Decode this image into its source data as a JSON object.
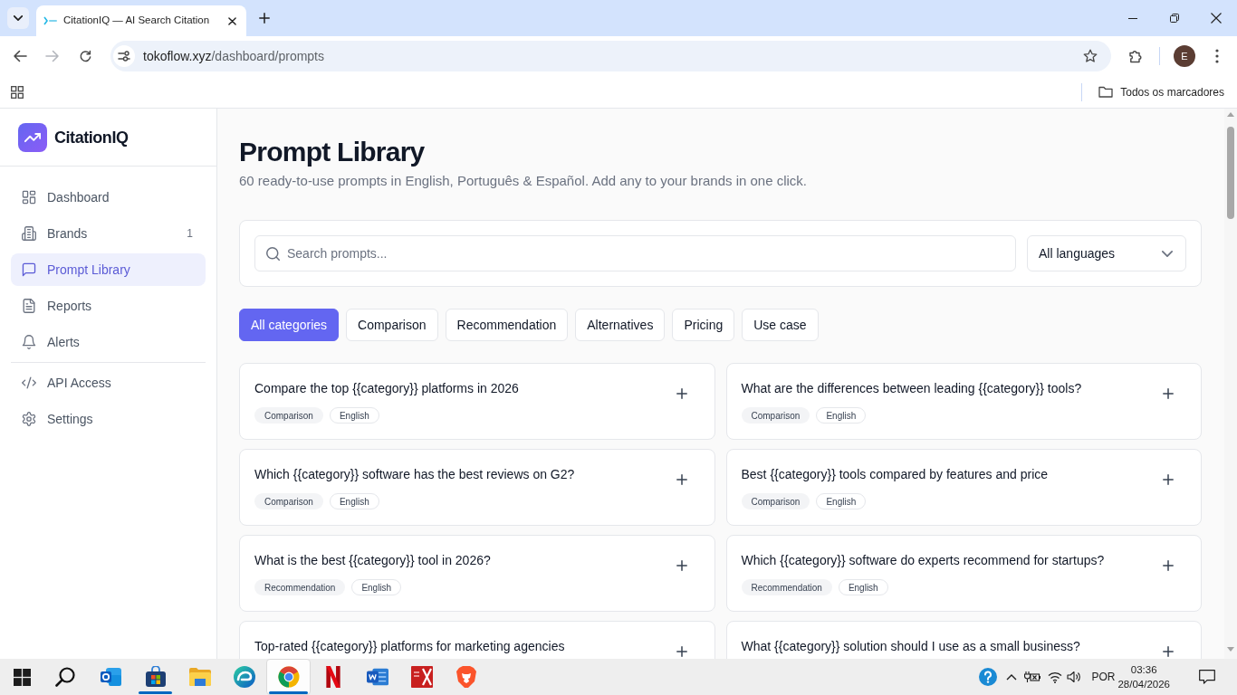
{
  "browser": {
    "tabs": [
      {
        "title": "CitationIQ — AI Search Citation",
        "selected": true
      }
    ],
    "address": {
      "host": "tokoflow.xyz",
      "path": "/dashboard/prompts"
    },
    "profile_initial": "E",
    "bookmarks_folder": "Todos os marcadores"
  },
  "sidebar": {
    "brand": "CitationIQ",
    "nav_groups": [
      [
        {
          "label": "Dashboard",
          "selected": false
        },
        {
          "label": "Brands",
          "count": "1",
          "selected": false
        },
        {
          "label": "Prompt Library",
          "selected": true
        },
        {
          "label": "Reports",
          "selected": false
        },
        {
          "label": "Alerts",
          "selected": false
        }
      ],
      [
        {
          "label": "API Access",
          "selected": false
        },
        {
          "label": "Settings",
          "selected": false
        }
      ]
    ]
  },
  "page": {
    "title": "Prompt Library",
    "subtitle": "60 ready-to-use prompts in English, Português & Español. Add any to your brands in one click."
  },
  "filters": {
    "search": {
      "placeholder": "Search prompts..."
    },
    "language": {
      "value": "All languages"
    },
    "categories": [
      {
        "label": "All categories",
        "selected": true
      },
      {
        "label": "Comparison",
        "selected": false
      },
      {
        "label": "Recommendation",
        "selected": false
      },
      {
        "label": "Alternatives",
        "selected": false
      },
      {
        "label": "Pricing",
        "selected": false
      },
      {
        "label": "Use case",
        "selected": false
      }
    ]
  },
  "prompts": [
    {
      "text": "Compare the top {{category}} platforms in 2026",
      "tags": [
        {
          "label": "Comparison",
          "kind": "category"
        },
        {
          "label": "English",
          "kind": "language"
        }
      ]
    },
    {
      "text": "What are the differences between leading {{category}} tools?",
      "tags": [
        {
          "label": "Comparison",
          "kind": "category"
        },
        {
          "label": "English",
          "kind": "language"
        }
      ]
    },
    {
      "text": "Which {{category}} software has the best reviews on G2?",
      "tags": [
        {
          "label": "Comparison",
          "kind": "category"
        },
        {
          "label": "English",
          "kind": "language"
        }
      ]
    },
    {
      "text": "Best {{category}} tools compared by features and price",
      "tags": [
        {
          "label": "Comparison",
          "kind": "category"
        },
        {
          "label": "English",
          "kind": "language"
        }
      ]
    },
    {
      "text": "What is the best {{category}} tool in 2026?",
      "tags": [
        {
          "label": "Recommendation",
          "kind": "category"
        },
        {
          "label": "English",
          "kind": "language"
        }
      ]
    },
    {
      "text": "Which {{category}} software do experts recommend for startups?",
      "tags": [
        {
          "label": "Recommendation",
          "kind": "category"
        },
        {
          "label": "English",
          "kind": "language"
        }
      ]
    },
    {
      "text": "Top-rated {{category}} platforms for marketing agencies"
    },
    {
      "text": "What {{category}} solution should I use as a small business?"
    }
  ],
  "taskbar": {
    "apps": [
      {
        "running": false,
        "selected": false
      },
      {
        "running": true,
        "selected": false
      },
      {
        "running": false,
        "selected": false
      },
      {
        "running": false,
        "selected": false
      },
      {
        "running": true,
        "selected": true
      },
      {
        "running": false,
        "selected": false
      },
      {
        "running": false,
        "selected": false
      },
      {
        "running": false,
        "selected": false
      },
      {
        "running": false,
        "selected": false
      }
    ],
    "tray": {
      "language": "POR",
      "time": "03:36",
      "date": "28/04/2026"
    }
  }
}
